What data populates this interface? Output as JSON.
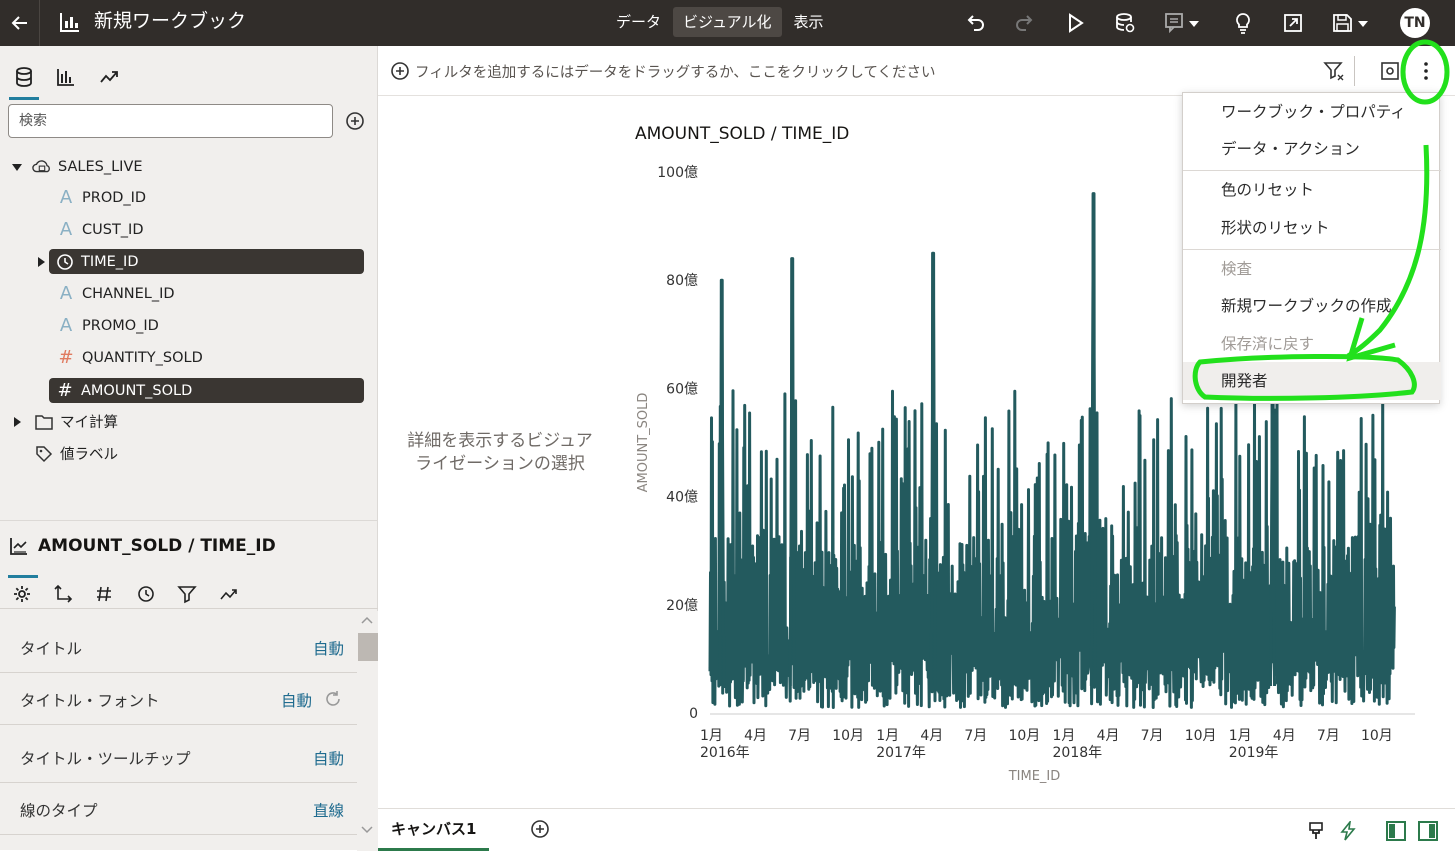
{
  "header": {
    "workbook_title": "新規ワークブック",
    "tabs": [
      {
        "label": "データ"
      },
      {
        "label": "ビジュアル化"
      },
      {
        "label": "表示"
      }
    ],
    "user_initials": "TN"
  },
  "data_panel": {
    "search_placeholder": "検索",
    "dataset": "SALES_LIVE",
    "columns": [
      {
        "label": "PROD_ID"
      },
      {
        "label": "CUST_ID"
      },
      {
        "label": "TIME_ID"
      },
      {
        "label": "CHANNEL_ID"
      },
      {
        "label": "PROMO_ID"
      },
      {
        "label": "QUANTITY_SOLD"
      },
      {
        "label": "AMOUNT_SOLD"
      }
    ],
    "my_calculations": "マイ計算",
    "value_labels": "値ラベル"
  },
  "properties_panel": {
    "title": "AMOUNT_SOLD / TIME_ID",
    "rows": [
      {
        "label": "タイトル",
        "value": "自動"
      },
      {
        "label": "タイトル・フォント",
        "value": "自動"
      },
      {
        "label": "タイトル・ツールチップ",
        "value": "自動"
      },
      {
        "label": "線のタイプ",
        "value": "直線"
      }
    ]
  },
  "filter_bar": {
    "hint": "フィルタを追加するにはデータをドラッグするか、ここをクリックしてください"
  },
  "canvas": {
    "hint_line1": "詳細を表示するビジュア",
    "hint_line2": "ライゼーションの選択",
    "tab_label": "キャンバス1"
  },
  "menu": {
    "items": [
      {
        "label": "ワークブック・プロパティ"
      },
      {
        "label": "データ・アクション"
      },
      {
        "label": "色のリセット"
      },
      {
        "label": "形状のリセット"
      },
      {
        "label": "検査"
      },
      {
        "label": "新規ワークブックの作成"
      },
      {
        "label": "保存済に戻す"
      },
      {
        "label": "開発者"
      }
    ]
  },
  "chart_data": {
    "type": "line",
    "title": "AMOUNT_SOLD / TIME_ID",
    "xlabel": "TIME_ID",
    "ylabel": "AMOUNT_SOLD",
    "ylim": [
      0,
      100
    ],
    "y_ticks": [
      {
        "value": 0,
        "label": "0"
      },
      {
        "value": 20,
        "label": "20億"
      },
      {
        "value": 40,
        "label": "40億"
      },
      {
        "value": 60,
        "label": "60億"
      },
      {
        "value": 80,
        "label": "80億"
      },
      {
        "value": 100,
        "label": "100億"
      }
    ],
    "x_ticks": [
      {
        "month": 0,
        "label": "1月",
        "year": "2016年"
      },
      {
        "month": 3,
        "label": "4月",
        "year": ""
      },
      {
        "month": 6,
        "label": "7月",
        "year": ""
      },
      {
        "month": 9,
        "label": "10月",
        "year": ""
      },
      {
        "month": 12,
        "label": "1月",
        "year": "2017年"
      },
      {
        "month": 15,
        "label": "4月",
        "year": ""
      },
      {
        "month": 18,
        "label": "7月",
        "year": ""
      },
      {
        "month": 21,
        "label": "10月",
        "year": ""
      },
      {
        "month": 24,
        "label": "1月",
        "year": "2018年"
      },
      {
        "month": 27,
        "label": "4月",
        "year": ""
      },
      {
        "month": 30,
        "label": "7月",
        "year": ""
      },
      {
        "month": 33,
        "label": "10月",
        "year": ""
      },
      {
        "month": 36,
        "label": "1月",
        "year": "2019年"
      },
      {
        "month": 39,
        "label": "4月",
        "year": ""
      },
      {
        "month": 42,
        "label": "7月",
        "year": ""
      },
      {
        "month": 45,
        "label": "10月",
        "year": ""
      }
    ],
    "series": [
      {
        "color": "#235a5e",
        "peaks": [
          {
            "month": 0.8,
            "value": 80
          },
          {
            "month": 5.6,
            "value": 84
          },
          {
            "month": 15.2,
            "value": 85
          },
          {
            "month": 26.1,
            "value": 96
          },
          {
            "month": 38.3,
            "value": 60
          }
        ]
      }
    ]
  }
}
